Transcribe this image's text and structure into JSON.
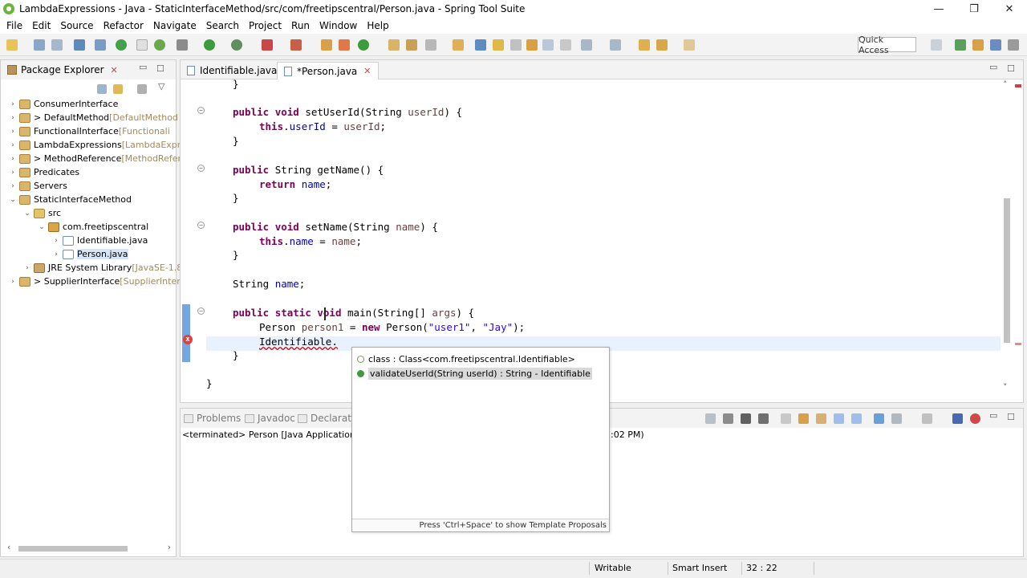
{
  "window": {
    "title": "LambdaExpressions - Java - StaticInterfaceMethod/src/com/freetipscentral/Person.java - Spring Tool Suite",
    "minimize": "—",
    "restore": "❐",
    "close": "✕"
  },
  "menu": [
    "File",
    "Edit",
    "Source",
    "Refactor",
    "Navigate",
    "Search",
    "Project",
    "Run",
    "Window",
    "Help"
  ],
  "toolbar": {
    "quick_access": "Quick Access"
  },
  "package_explorer": {
    "title": "Package Explorer",
    "close": "✕",
    "items": [
      {
        "arrow": "›",
        "label": "ConsumerInterface",
        "suffix": ""
      },
      {
        "arrow": "›",
        "label": "> DefaultMethod",
        "suffix": "[DefaultMethod"
      },
      {
        "arrow": "›",
        "label": "FunctionalInterface",
        "suffix": "[Functionali"
      },
      {
        "arrow": "›",
        "label": "LambdaExpressions",
        "suffix": "[LambdaExpre"
      },
      {
        "arrow": "›",
        "label": "> MethodReference",
        "suffix": "[MethodRefer"
      },
      {
        "arrow": "›",
        "label": "Predicates",
        "suffix": ""
      },
      {
        "arrow": "›",
        "label": "Servers",
        "suffix": ""
      },
      {
        "arrow": "⌄",
        "label": "StaticInterfaceMethod",
        "suffix": ""
      },
      {
        "arrow": "⌄",
        "label": "src",
        "suffix": ""
      },
      {
        "arrow": "⌄",
        "label": "com.freetipscentral",
        "suffix": ""
      },
      {
        "arrow": "›",
        "label": "Identifiable.java",
        "suffix": ""
      },
      {
        "arrow": "›",
        "label": "Person.java",
        "suffix": ""
      },
      {
        "arrow": "›",
        "label": "JRE System Library",
        "suffix": "[JavaSE-1.8]"
      },
      {
        "arrow": "›",
        "label": "> SupplierInterface",
        "suffix": "[SupplierInterfa"
      }
    ]
  },
  "editor": {
    "tabs": [
      {
        "label": "Identifiable.java",
        "close": ""
      },
      {
        "label": "*Person.java",
        "close": "✕"
      }
    ],
    "code_lines": [
      "}",
      "public void setUserId(String userId) {",
      "this.userId = userId;",
      "}",
      "public String getName() {",
      "return name;",
      "}",
      "public void setName(String name) {",
      "this.name = name;",
      "}",
      "String name;",
      "public static void main(String[] args) {",
      "Person person1 = new Person(\"user1\", \"Jay\");",
      "Identifiable.",
      "}",
      "}"
    ],
    "tokens": {
      "public": "public",
      "void": "void",
      "static": "static",
      "return": "return",
      "this": "this",
      "new": "new",
      "String": "String",
      "setUserId": "setUserId(",
      "getName": "getName() {",
      "setName": "setName(",
      "main": "main(",
      "userId": "userId",
      "name": "name",
      "args": "args",
      "person1": "person1",
      "user1": "\"user1\"",
      "jay": "\"Jay\"",
      "Person": "Person",
      "Identifiable": "Identifiable",
      "dot": "."
    },
    "error_marker": "x"
  },
  "content_assist": {
    "items": [
      "class : Class<com.freetipscentral.Identifiable>",
      "validateUserId(String userId) : String - Identifiable"
    ],
    "footer": "Press 'Ctrl+Space' to show Template Proposals"
  },
  "console": {
    "tabs": [
      "Problems",
      "Javadoc",
      "Declaration"
    ],
    "status": "<terminated> Person [Java Application] C:\\",
    "status_end": ":02 PM)"
  },
  "statusbar": {
    "writable": "Writable",
    "insert_mode": "Smart Insert",
    "position": "32 : 22"
  }
}
